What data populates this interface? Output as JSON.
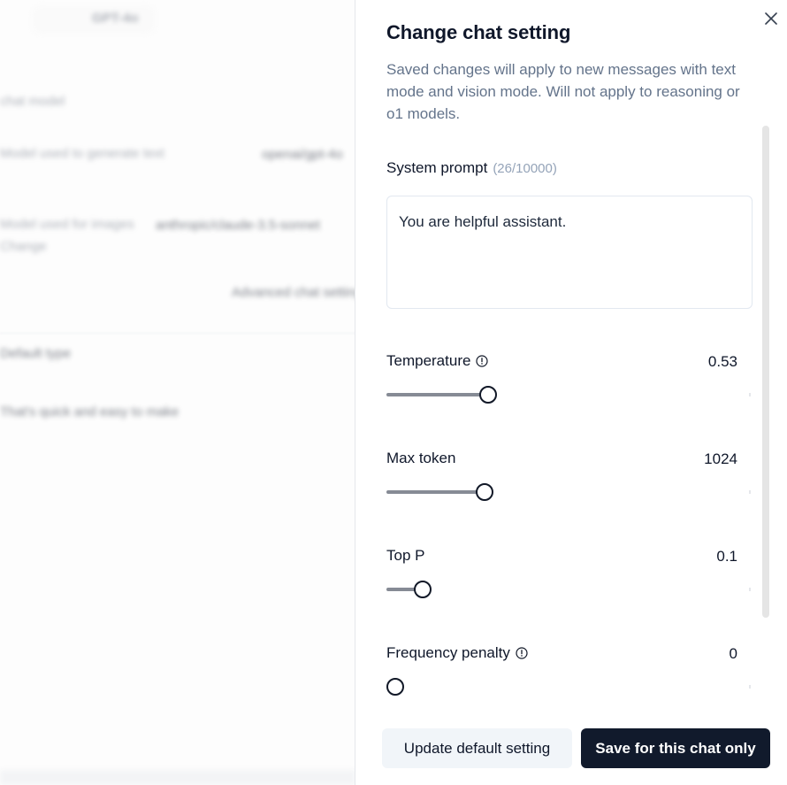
{
  "background": {
    "blurred_texts": [
      "GPT-4o",
      "chat model",
      "Model used to generate text",
      "openai/gpt-4o",
      "Model used for images",
      "anthropic/claude-3.5-sonnet",
      "Change",
      "Advanced chat settings",
      "Default type",
      "That's quick and easy to make"
    ]
  },
  "drawer": {
    "title": "Change chat setting",
    "subtitle": "Saved changes will apply to new messages with text mode and vision mode. Will not apply to reasoning or o1 models.",
    "close_icon": "close-icon",
    "system_prompt": {
      "label": "System prompt",
      "counter": "(26/10000)",
      "value": "You are helpful assistant."
    },
    "sliders": [
      {
        "label": "Temperature",
        "has_info_icon": true,
        "value_text": "0.53",
        "fill_fraction": 0.28
      },
      {
        "label": "Max token",
        "has_info_icon": false,
        "value_text": "1024",
        "fill_fraction": 0.27
      },
      {
        "label": "Top P",
        "has_info_icon": false,
        "value_text": "0.1",
        "fill_fraction": 0.1
      },
      {
        "label": "Frequency penalty",
        "has_info_icon": true,
        "value_text": "0",
        "fill_fraction": 0.0
      }
    ],
    "buttons": {
      "update_default": "Update default setting",
      "save_chat_only": "Save for this chat only"
    }
  },
  "colors": {
    "primary_button": "#111a2c",
    "secondary_button": "#f1f5f9",
    "subtitle_text": "#64748b",
    "slider_track": "#868b95"
  }
}
